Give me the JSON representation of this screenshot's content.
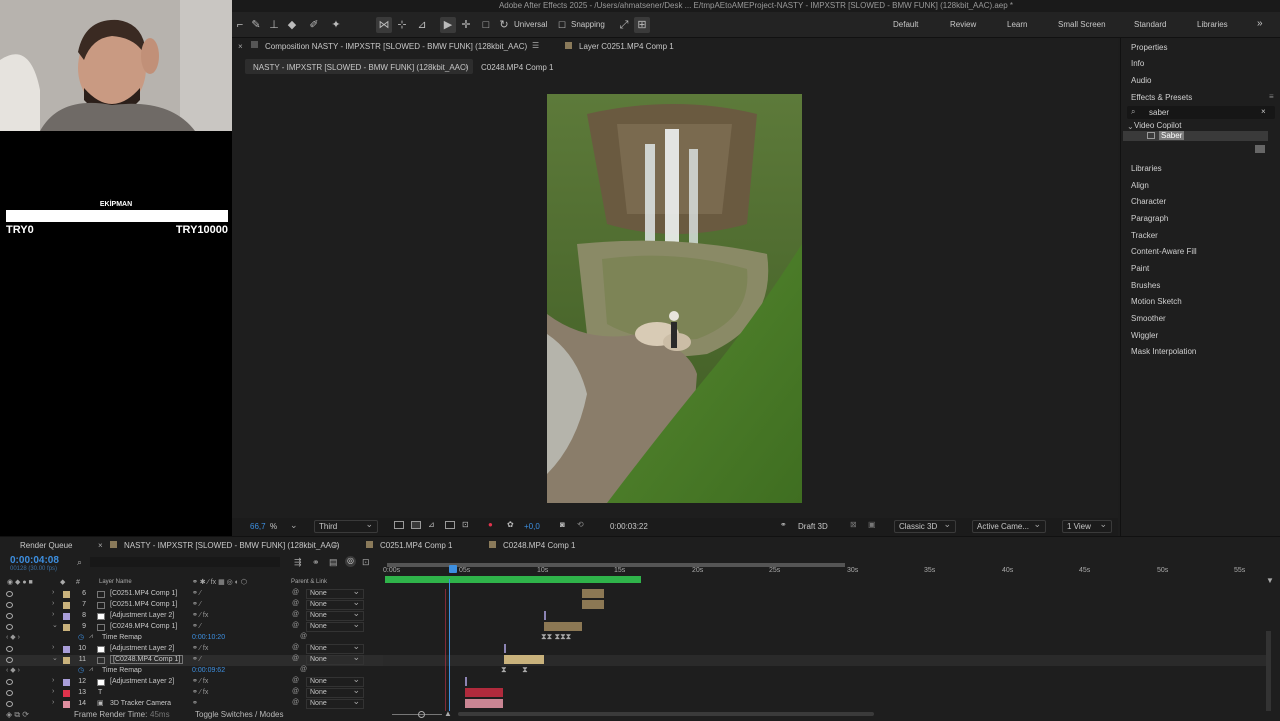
{
  "app": {
    "title": "Adobe After Effects 2025 - /Users/ahmatsener/Desk ... E/tmpAEtoAMEProject-NASTY - IMPXSTR [SLOWED - BMW FUNK] (128kbit_AAC).aep *"
  },
  "toolbar": {
    "universal_label": "Universal",
    "snapping_label": "Snapping",
    "workspaces": [
      "Default",
      "Review",
      "Learn",
      "Small Screen",
      "Standard",
      "Libraries"
    ]
  },
  "overlay": {
    "heading": "EKİPMAN",
    "left_value": "TRY0",
    "right_value": "TRY10000"
  },
  "comp_panel": {
    "comp_tab": "Composition NASTY - IMPXSTR [SLOWED - BMW FUNK] (128kbit_AAC)",
    "layer_tab": "Layer C0251.MP4 Comp 1",
    "breadcrumb_1": "NASTY - IMPXSTR [SLOWED - BMW FUNK] (128kbit_AAC)",
    "breadcrumb_2": "C0248.MP4 Comp 1"
  },
  "viewer_bar": {
    "zoom": "66,7",
    "zoom_unit": "%",
    "resolution": "Third",
    "exposure": "+0,0",
    "timecode": "0:00:03:22",
    "draft": "Draft 3D",
    "renderer": "Classic 3D",
    "camera": "Active Came...",
    "views": "1 View"
  },
  "right_panel": {
    "items_top": [
      "Properties",
      "Info",
      "Audio",
      "Effects & Presets"
    ],
    "search_value": "saber",
    "tree_folder": "Video Copilot",
    "tree_item": "Saber",
    "items_bottom": [
      "Libraries",
      "Align",
      "Character",
      "Paragraph",
      "Tracker",
      "Content-Aware Fill",
      "Paint",
      "Brushes",
      "Motion Sketch",
      "Smoother",
      "Wiggler",
      "Mask Interpolation"
    ]
  },
  "timeline": {
    "render_queue_tab": "Render Queue",
    "comp_tab": "NASTY - IMPXSTR [SLOWED - BMW FUNK] (128kbit_AAC)",
    "tab_2": "C0251.MP4 Comp 1",
    "tab_3": "C0248.MP4 Comp 1",
    "current_time": "0:00:04:08",
    "fps_note": "00128 (30.00 fps)",
    "col_hash": "#",
    "col_layer_name": "Layer Name",
    "col_parent": "Parent & Link",
    "ruler_labels": [
      "0:00s",
      "05s",
      "10s",
      "15s",
      "20s",
      "25s",
      "30s",
      "35s",
      "40s",
      "45s",
      "50s",
      "55s"
    ],
    "layers": [
      {
        "num": "6",
        "name": "[C0251.MP4 Comp 1]",
        "parent": "None",
        "color": "#c9b27c"
      },
      {
        "num": "7",
        "name": "[C0251.MP4 Comp 1]",
        "parent": "None",
        "color": "#c9b27c"
      },
      {
        "num": "8",
        "name": "[Adjustment Layer 2]",
        "parent": "None",
        "color": "#a99ed9"
      },
      {
        "num": "9",
        "name": "[C0249.MP4 Comp 1]",
        "parent": "None",
        "color": "#c9b27c"
      },
      {
        "num": "10",
        "name": "[Adjustment Layer 2]",
        "parent": "None",
        "color": "#a99ed9"
      },
      {
        "num": "11",
        "name": "[C0248.MP4 Comp 1]",
        "parent": "None",
        "color": "#c9b27c"
      },
      {
        "num": "12",
        "name": "[Adjustment Layer 2]",
        "parent": "None",
        "color": "#a99ed9"
      },
      {
        "num": "13",
        "name": "T",
        "parent": "None",
        "color": "#e0334c"
      },
      {
        "num": "14",
        "name": "3D Tracker Camera",
        "parent": "None",
        "color": "#e08fa0"
      }
    ],
    "remap_1_label": "Time Remap",
    "remap_1_value": "0:00:10:20",
    "remap_2_label": "Time Remap",
    "remap_2_value": "0:00:09:62",
    "frame_render_label": "Frame Render Time:",
    "frame_render_value": "45ms",
    "toggle_label": "Toggle Switches / Modes"
  },
  "colors": {
    "accent_blue": "#3d8fe0",
    "work_area_green": "#2fb34a",
    "layer_tan": "#b59b6a",
    "layer_red": "#b02a3c",
    "layer_pink": "#c98593"
  }
}
